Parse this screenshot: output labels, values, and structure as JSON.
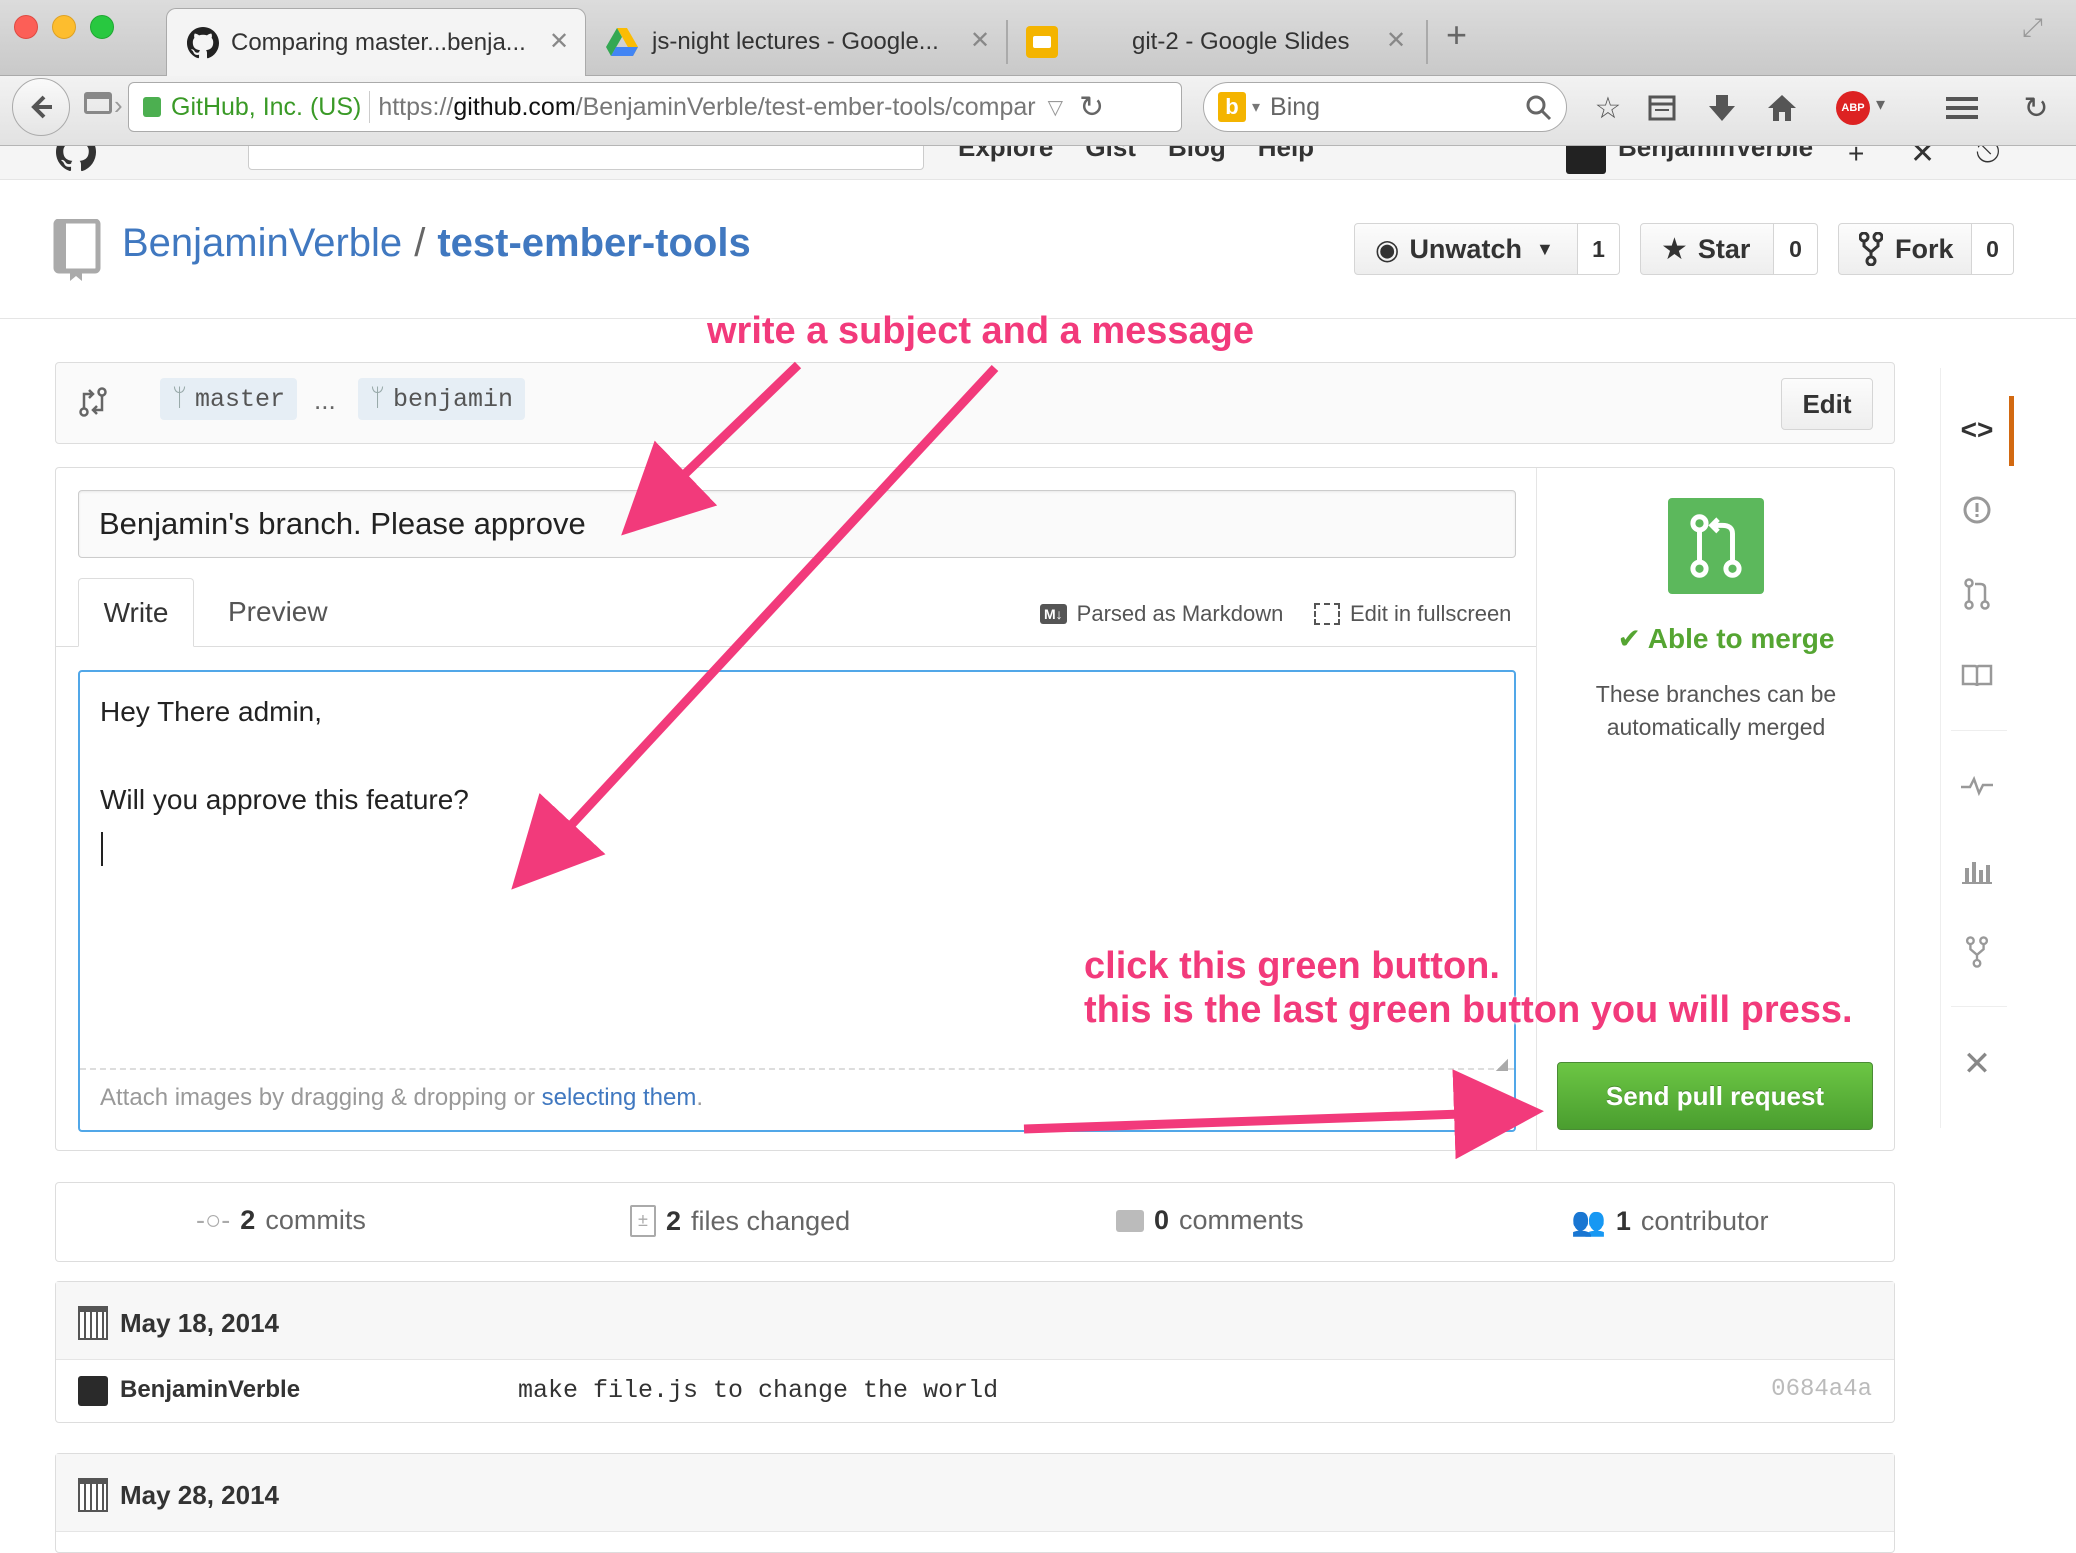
{
  "browser": {
    "tabs": [
      {
        "title": "Comparing master...benja...",
        "icon": "github-icon"
      },
      {
        "title": "js-night lectures - Google...",
        "icon": "google-drive-icon"
      },
      {
        "title": "git-2 - Google Slides",
        "icon": "google-slides-icon"
      }
    ],
    "new_tab": "+",
    "identity": "GitHub, Inc. (US)",
    "url_scheme": "https://",
    "url_host": "github.com",
    "url_path": "/BenjaminVerble/test-ember-tools/compar",
    "search_engine": "Bing",
    "search_placeholder": "Bing",
    "abp_label": "ABP"
  },
  "repo": {
    "owner": "BenjaminVerble",
    "separator": "/",
    "name": "test-ember-tools",
    "unwatch_label": "Unwatch",
    "unwatch_count": "1",
    "star_label": "Star",
    "star_count": "0",
    "fork_label": "Fork",
    "fork_count": "0"
  },
  "compare": {
    "base": "master",
    "ellipsis": "...",
    "head": "benjamin",
    "edit_label": "Edit"
  },
  "pr_form": {
    "title_value": "Benjamin's branch. Please approve",
    "tab_write": "Write",
    "tab_preview": "Preview",
    "markdown_hint": "Parsed as Markdown",
    "fullscreen_hint": "Edit in fullscreen",
    "body_line1": "Hey There admin,",
    "body_line2": "Will you approve this feature?",
    "attach_text": "Attach images by dragging & dropping or ",
    "attach_link": "selecting them",
    "attach_end": "."
  },
  "merge_box": {
    "status": "Able to merge",
    "description_line1": "These branches can be",
    "description_line2": "automatically merged",
    "send_button": "Send pull request",
    "color": "#5cb85c"
  },
  "annotations": {
    "subject_message": "write a subject and a message",
    "green_button_line1": "click this green button.",
    "green_button_line2": "this is the last green button you will press.",
    "color": "#f23a7b"
  },
  "stats": {
    "commits_count": "2",
    "commits_label": "commits",
    "files_count": "2",
    "files_label": "files changed",
    "comments_count": "0",
    "comments_label": "comments",
    "contributors_count": "1",
    "contributors_label": "contributor"
  },
  "commits": {
    "group1_date": "May 18, 2014",
    "group1_rows": [
      {
        "author": "BenjaminVerble",
        "message": "make file.js to change the world",
        "sha": "0684a4a"
      }
    ],
    "group2_date": "May 28, 2014"
  },
  "gh_nav_partial": [
    "Explore",
    "Gist",
    "Blog",
    "Help"
  ],
  "gh_user_partial": "BenjaminVerble"
}
